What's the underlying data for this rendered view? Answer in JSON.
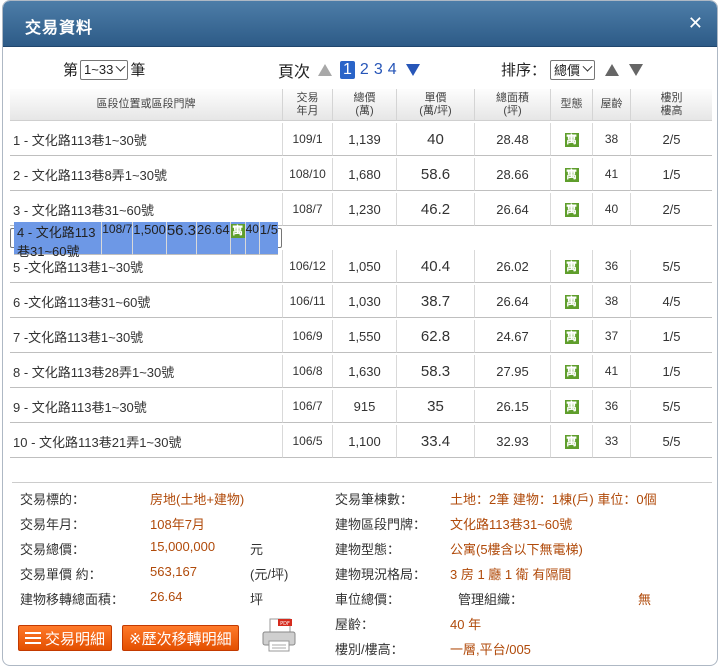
{
  "window": {
    "title": "交易資料",
    "close_icon": "close-icon"
  },
  "pager": {
    "prefix": "第",
    "selected": "1~33",
    "suffix": "筆"
  },
  "pages": {
    "label": "頁次",
    "items": [
      "1",
      "2",
      "3",
      "4"
    ],
    "current": "1"
  },
  "sort": {
    "label": "排序：",
    "selected": "總價"
  },
  "table": {
    "headers": [
      "區段位置或區段門牌",
      "交易\n年月",
      "總價\n(萬)",
      "單價\n(萬/坪)",
      "總面積\n(坪)",
      "型態",
      "屋齡",
      "樓別\n樓高"
    ],
    "rows": [
      {
        "addr": "1 - 文化路113巷1~30號",
        "ym": "109/1",
        "total": "1,139",
        "unit": "40",
        "area": "28.48",
        "type": "寓",
        "age": "38",
        "floor": "2/5"
      },
      {
        "addr": "2 - 文化路113巷8弄1~30號",
        "ym": "108/10",
        "total": "1,680",
        "unit": "58.6",
        "area": "28.66",
        "type": "寓",
        "age": "41",
        "floor": "1/5"
      },
      {
        "addr": "3 - 文化路113巷31~60號",
        "ym": "108/7",
        "total": "1,230",
        "unit": "46.2",
        "area": "26.64",
        "type": "寓",
        "age": "40",
        "floor": "2/5"
      },
      {
        "addr": "4 - 文化路113巷31~60號",
        "ym": "108/7",
        "total": "1,500",
        "unit": "56.3",
        "area": "26.64",
        "type": "寓",
        "age": "40",
        "floor": "1/5"
      },
      {
        "addr": "5 -文化路113巷1~30號",
        "ym": "106/12",
        "total": "1,050",
        "unit": "40.4",
        "area": "26.02",
        "type": "寓",
        "age": "36",
        "floor": "5/5"
      },
      {
        "addr": "6 -文化路113巷31~60號",
        "ym": "106/11",
        "total": "1,030",
        "unit": "38.7",
        "area": "26.64",
        "type": "寓",
        "age": "38",
        "floor": "4/5"
      },
      {
        "addr": "7 -文化路113巷1~30號",
        "ym": "106/9",
        "total": "1,550",
        "unit": "62.8",
        "area": "24.67",
        "type": "寓",
        "age": "37",
        "floor": "1/5"
      },
      {
        "addr": "8 - 文化路113巷28弄1~30號",
        "ym": "106/8",
        "total": "1,630",
        "unit": "58.3",
        "area": "27.95",
        "type": "寓",
        "age": "41",
        "floor": "1/5"
      },
      {
        "addr": "9 - 文化路113巷1~30號",
        "ym": "106/7",
        "total": "915",
        "unit": "35",
        "area": "26.15",
        "type": "寓",
        "age": "36",
        "floor": "5/5"
      },
      {
        "addr": "10 - 文化路113巷21弄1~30號",
        "ym": "106/5",
        "total": "1,100",
        "unit": "33.4",
        "area": "32.93",
        "type": "寓",
        "age": "33",
        "floor": "5/5"
      }
    ],
    "selected_row": 3
  },
  "detail": {
    "target_label": "交易標的：",
    "target": "房地(土地+建物)",
    "ym_label": "交易年月：",
    "ym": "108年7月",
    "total_label": "交易總價：",
    "total": "15,000,000",
    "total_unit": "元",
    "unitprice_label": "交易單價 約：",
    "unitprice": "563,167",
    "unitprice_unit": "(元/坪)",
    "area_label": "建物移轉總面積：",
    "area": "26.64",
    "area_unit": "坪",
    "count_label": "交易筆棟數：",
    "count": "土地：2筆 建物：1棟(戶) 車位：0個",
    "door_label": "建物區段門牌：",
    "door": "文化路113巷31~60號",
    "btype_label": "建物型態：",
    "btype": "公寓(5樓含以下無電梯)",
    "layout_label": "建物現況格局：",
    "layout": "3 房 1 廳 1 衛 有隔間",
    "parking_label": "車位總價：",
    "mgmt_label": "管理組織：",
    "mgmt": "無",
    "age_label": "屋齡：",
    "age": "40 年",
    "floor_label": "樓別/樓高：",
    "floor": "一層,平台/005"
  },
  "buttons": {
    "detail": "交易明細",
    "history": "※歷次移轉明細"
  },
  "icons": {
    "printer": "pdf-printer-icon"
  }
}
